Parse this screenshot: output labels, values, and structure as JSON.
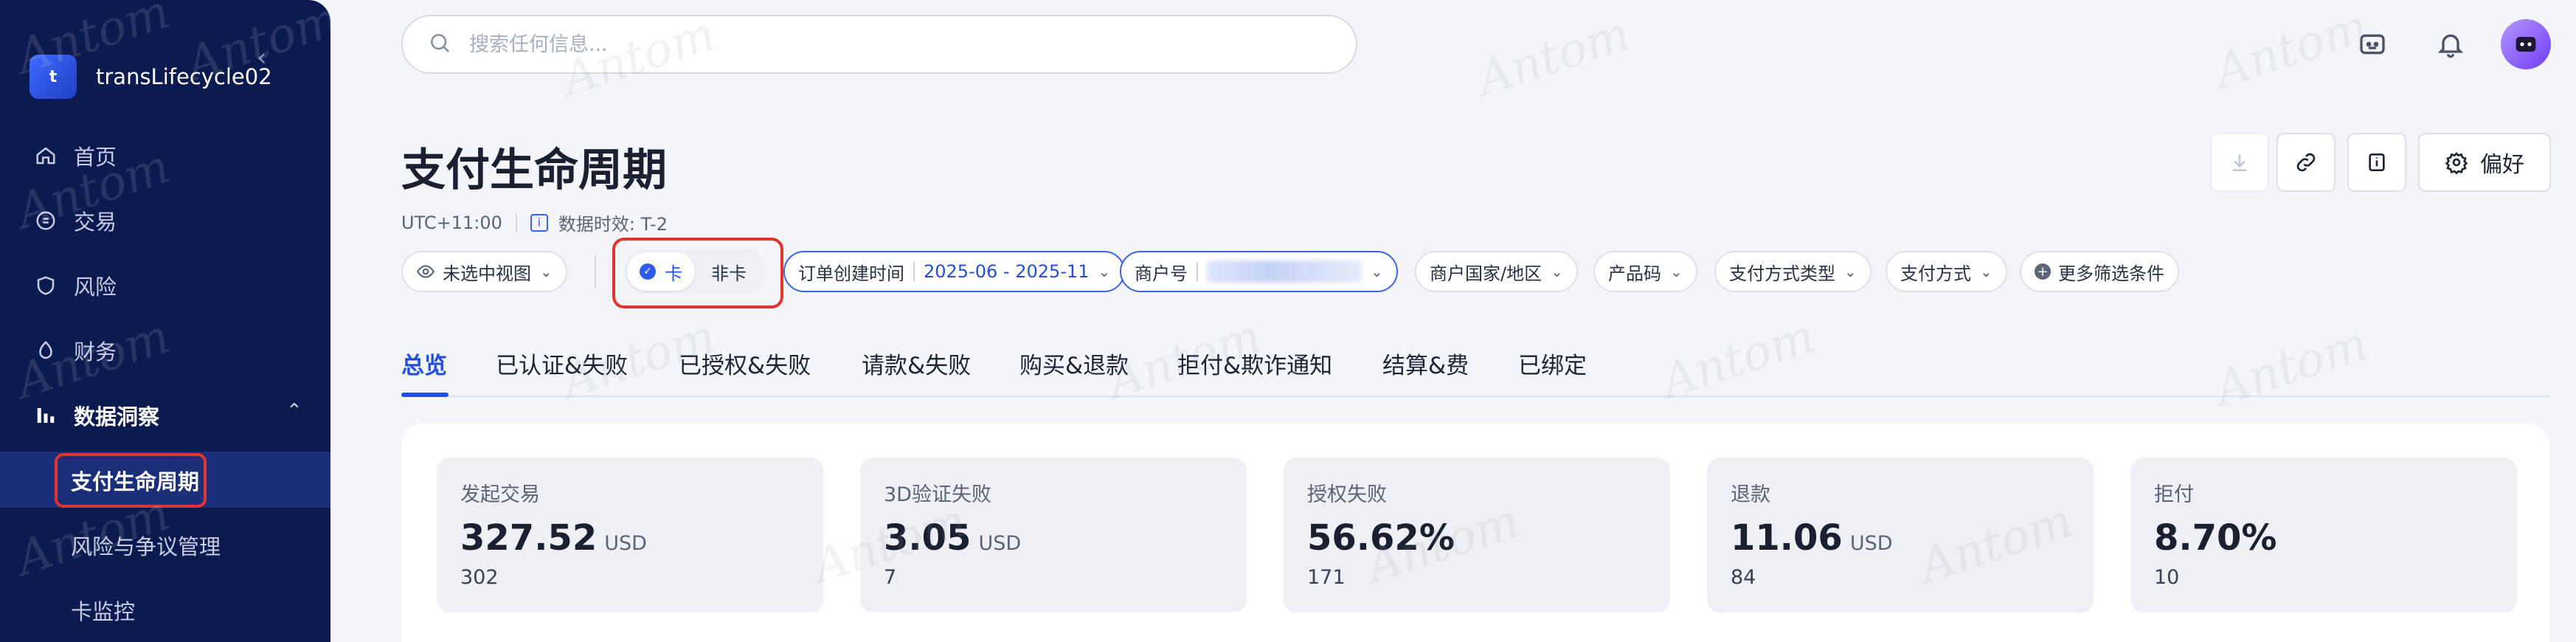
{
  "brand": {
    "logo_letter": "t",
    "name": "transLifecycle02"
  },
  "sidebar": {
    "items": [
      {
        "label": "首页",
        "icon": "home-icon"
      },
      {
        "label": "交易",
        "icon": "transaction-icon"
      },
      {
        "label": "风险",
        "icon": "shield-icon"
      },
      {
        "label": "财务",
        "icon": "finance-icon"
      },
      {
        "label": "数据洞察",
        "icon": "chart-icon"
      }
    ],
    "sub_items": [
      {
        "label": "支付生命周期"
      },
      {
        "label": "风险与争议管理"
      },
      {
        "label": "卡监控"
      }
    ]
  },
  "search": {
    "placeholder": "搜索任何信息..."
  },
  "page": {
    "title": "支付生命周期",
    "timezone": "UTC+11:00",
    "data_freshness": "数据时效: T-2",
    "pref_label": "偏好"
  },
  "filters": {
    "view": "未选中视图",
    "card_toggle": {
      "on": "卡",
      "off": "非卡"
    },
    "order_time": {
      "label": "订单创建时间",
      "value": "2025-06 - 2025-11"
    },
    "merchant": {
      "label": "商户号"
    },
    "country": "商户国家/地区",
    "product": "产品码",
    "pay_type": "支付方式类型",
    "pay_method": "支付方式",
    "more": "更多筛选条件"
  },
  "tabs": [
    "总览",
    "已认证&失败",
    "已授权&失败",
    "请款&失败",
    "购买&退款",
    "拒付&欺诈通知",
    "结算&费",
    "已绑定"
  ],
  "stats": [
    {
      "label": "发起交易",
      "value": "327.52",
      "unit": "USD",
      "count": "302"
    },
    {
      "label": "3D验证失败",
      "value": "3.05",
      "unit": "USD",
      "count": "7"
    },
    {
      "label": "授权失败",
      "value": "56.62%",
      "unit": "",
      "count": "171"
    },
    {
      "label": "退款",
      "value": "11.06",
      "unit": "USD",
      "count": "84"
    },
    {
      "label": "拒付",
      "value": "8.70%",
      "unit": "",
      "count": "10"
    }
  ],
  "watermark": "Antom",
  "colors": {
    "sidebar_bg": "#0b1a4f",
    "accent": "#2450d9",
    "highlight": "#e1342f"
  }
}
